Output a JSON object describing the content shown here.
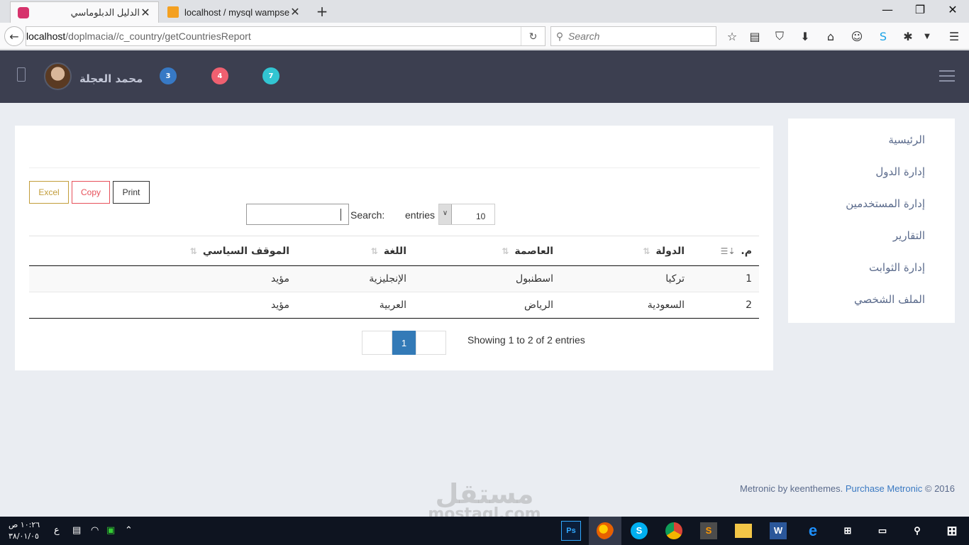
{
  "browser": {
    "tabs": [
      {
        "label": "الدليل الدبلوماسي",
        "active": true
      },
      {
        "label": "localhost / mysql wampse...",
        "active": false
      }
    ],
    "url_host": "localhost",
    "url_path": "/doplmacia//c_country/getCountriesReport",
    "search_placeholder": "Search"
  },
  "header": {
    "user_name": "محمد العجلة",
    "badges": [
      {
        "count": "3",
        "color": "#3779c5"
      },
      {
        "count": "4",
        "color": "#ef6070"
      },
      {
        "count": "7",
        "color": "#32c5d2"
      }
    ]
  },
  "sidebar": {
    "items": [
      {
        "label": "الرئيسية"
      },
      {
        "label": "إدارة الدول"
      },
      {
        "label": "إدارة المستخدمين"
      },
      {
        "label": "التقارير"
      },
      {
        "label": "إدارة الثوابت"
      },
      {
        "label": "الملف الشخصي"
      }
    ]
  },
  "toolbar": {
    "excel_label": "Excel",
    "copy_label": "Copy",
    "print_label": "Print"
  },
  "filter": {
    "search_label": "Search:",
    "entries_label": "entries",
    "page_length": "10"
  },
  "table": {
    "columns": [
      "م.",
      "الدولة",
      "العاصمة",
      "اللغة",
      "الموقف السياسي"
    ],
    "rows": [
      [
        "1",
        "تركيا",
        "اسطنبول",
        "الإنجليزية",
        "مؤيد"
      ],
      [
        "2",
        "السعودية",
        "الرياض",
        "العربية",
        "مؤيد"
      ]
    ]
  },
  "pagination": {
    "current_page": "1",
    "info": "Showing 1 to 2 of 2 entries"
  },
  "footer": {
    "text": "© 2016",
    "link": "Purchase Metronic",
    "credit": "Metronic by keenthemes."
  },
  "watermark": {
    "arabic": "مستقل",
    "latin": "mostaql.com"
  },
  "taskbar": {
    "time": "١٠:٢٦ ص",
    "date": "٣٨/٠١/٠٥",
    "lang": "ع"
  },
  "colors": {
    "header_bg": "#3c3f50",
    "page_bg": "#eaedf2",
    "accent": "#337ab7"
  }
}
